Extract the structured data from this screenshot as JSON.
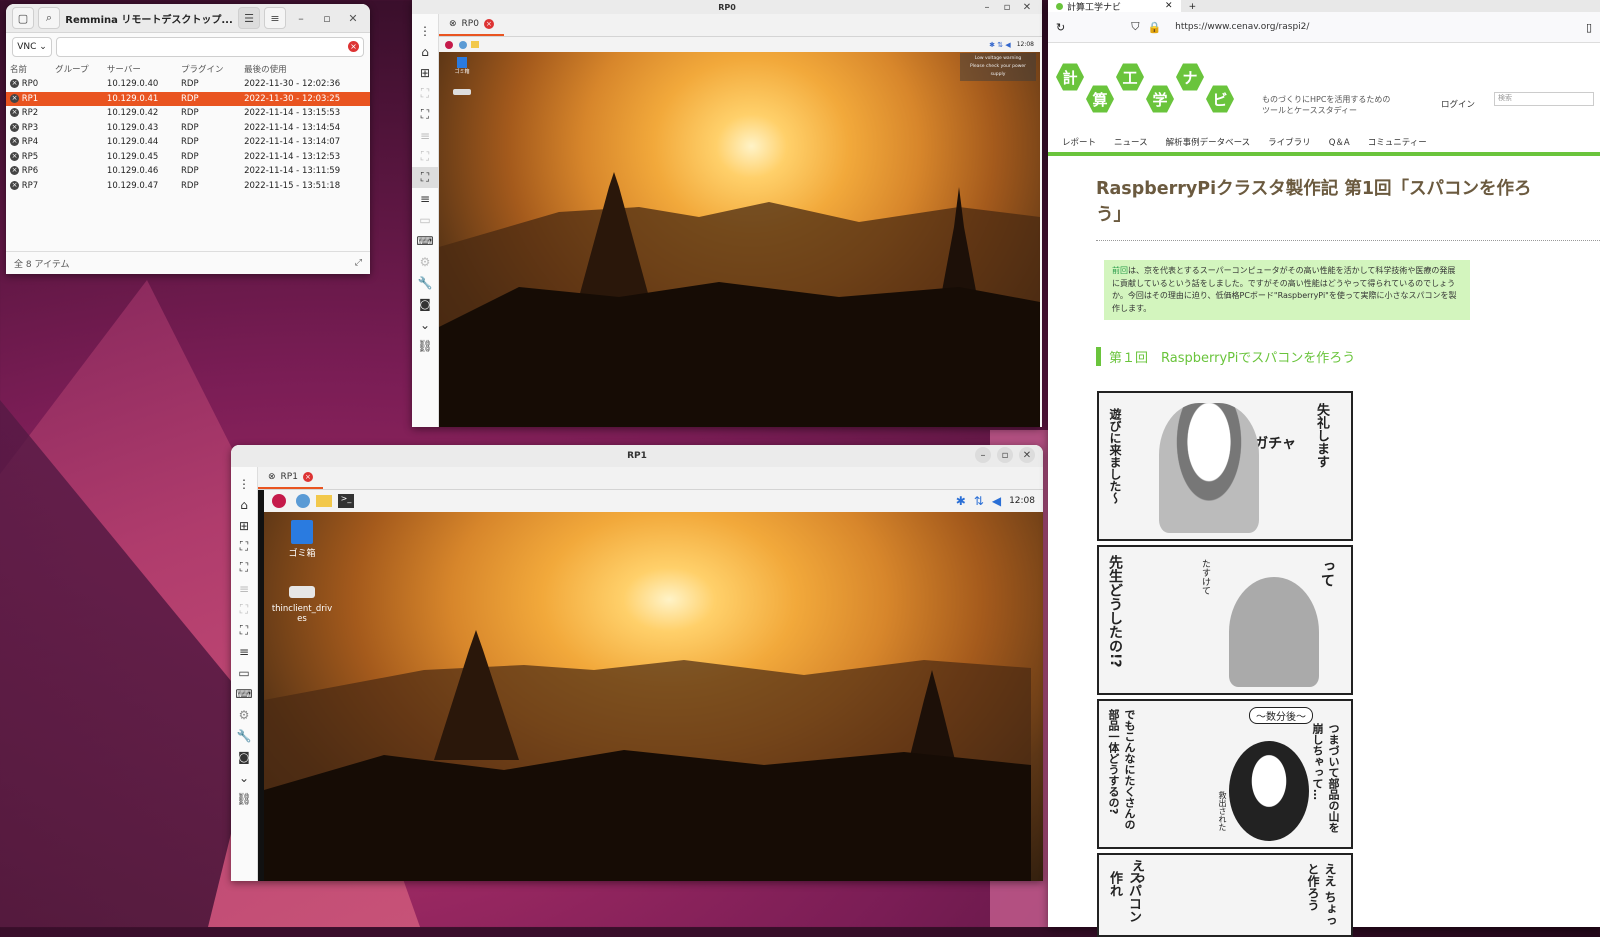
{
  "colors": {
    "accent": "#e95420",
    "close": "#dd3333",
    "brand_green": "#6ac43c"
  },
  "remmina": {
    "title": "Remmina リモートデスクトップ...",
    "protocol": "VNC",
    "columns": [
      "名前",
      "グループ",
      "サーバー",
      "プラグイン",
      "最後の使用"
    ],
    "rows": [
      {
        "name": "RP0",
        "group": "",
        "server": "10.129.0.40",
        "plugin": "RDP",
        "last": "2022-11-30 - 12:02:36"
      },
      {
        "name": "RP1",
        "group": "",
        "server": "10.129.0.41",
        "plugin": "RDP",
        "last": "2022-11-30 - 12:03:25",
        "selected": true
      },
      {
        "name": "RP2",
        "group": "",
        "server": "10.129.0.42",
        "plugin": "RDP",
        "last": "2022-11-14 - 13:15:53"
      },
      {
        "name": "RP3",
        "group": "",
        "server": "10.129.0.43",
        "plugin": "RDP",
        "last": "2022-11-14 - 13:14:54"
      },
      {
        "name": "RP4",
        "group": "",
        "server": "10.129.0.44",
        "plugin": "RDP",
        "last": "2022-11-14 - 13:14:07"
      },
      {
        "name": "RP5",
        "group": "",
        "server": "10.129.0.45",
        "plugin": "RDP",
        "last": "2022-11-14 - 13:12:53"
      },
      {
        "name": "RP6",
        "group": "",
        "server": "10.129.0.46",
        "plugin": "RDP",
        "last": "2022-11-14 - 13:11:59"
      },
      {
        "name": "RP7",
        "group": "",
        "server": "10.129.0.47",
        "plugin": "RDP",
        "last": "2022-11-15 - 13:51:18"
      }
    ],
    "status": "全 8 アイテム"
  },
  "rp0": {
    "title": "RP0",
    "tab": "RP0",
    "clock": "12:08",
    "desktop_icon": "ゴミ箱",
    "warning": [
      "Low voltage warning",
      "Please check your power supply"
    ]
  },
  "rp1": {
    "title": "RP1",
    "tab": "RP1",
    "clock": "12:08",
    "icons": [
      "ゴミ箱",
      "thinclient_drives"
    ]
  },
  "browser": {
    "tab": "計算工学ナビ",
    "url": "https://www.cenav.org/raspi2/",
    "logo": [
      "計",
      "算",
      "工",
      "学",
      "ナ",
      "ビ"
    ],
    "tagline1": "ものづくりにHPCを活用するための",
    "tagline2": "ツールとケーススタディー",
    "login": "ログイン",
    "search_placeholder": "検索",
    "nav": [
      "レポート",
      "ニュース",
      "解析事例データベース",
      "ライブラリ",
      "Q＆A",
      "コミュニティー"
    ],
    "title1": "RaspberryPiクラスタ製作記 第1回「スパコンを作ろ",
    "title2": "う」",
    "intro_link": "前回",
    "intro": "は、京を代表とするスーパーコンピュータがその高い性能を活かして科学技術や医療の発展に貢献しているという話をしました。ですがその高い性能はどうやって得られているのでしょうか。今回はその理由に迫り、低価格PCボード\"RaspberryPi\"を使って実際に小さなスパコンを製作します。",
    "section": "第１回　RaspberryPiでスパコンを作ろう",
    "comic": [
      [
        "失礼します",
        "ガチャ",
        "遊びに来ました〜"
      ],
      [
        "って",
        "たすけて",
        "先生どうしたの!?"
      ],
      [
        "〜数分後〜",
        "つまづいて部品の山を崩しちゃって…",
        "でもこんなにたくさんの部品一体どうするの?",
        "救出された"
      ],
      [
        "ええ ちょっと作ろう",
        "えっ",
        "スパコン作れ"
      ]
    ]
  }
}
